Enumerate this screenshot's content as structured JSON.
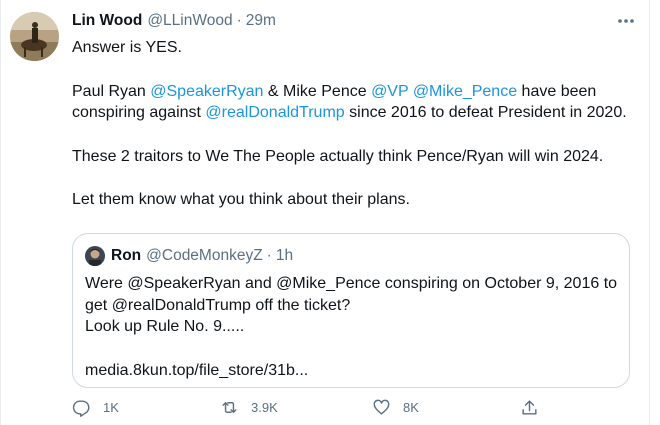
{
  "tweet": {
    "author_name": "Lin Wood",
    "author_handle": "@LLinWood",
    "separator": "·",
    "time": "29m",
    "line1": "Answer is YES.",
    "para2": {
      "t1": "Paul Ryan ",
      "m1": "@SpeakerRyan",
      "t2": " & Mike Pence ",
      "m2": "@VP",
      "t3": " ",
      "m3": "@Mike_Pence",
      "t4": " have been conspiring against ",
      "m4": "@realDonaldTrump",
      "t5": " since 2016 to defeat President in 2020."
    },
    "para3": "These 2 traitors to We The People actually think Pence/Ryan will win 2024.",
    "para4": "Let them know what you think about their plans."
  },
  "quote": {
    "author_name": "Ron",
    "author_handle": "@CodeMonkeyZ",
    "separator": "·",
    "time": "1h",
    "line1": "Were @SpeakerRyan and @Mike_Pence conspiring on October 9, 2016 to get @realDonaldTrump off the ticket?",
    "line2": "Look up Rule No. 9.....",
    "link": "media.8kun.top/file_store/31b..."
  },
  "actions": {
    "reply_count": "1K",
    "retweet_count": "3.9K",
    "like_count": "8K"
  },
  "icons": {
    "more": "more-horizontal-icon",
    "reply": "reply-icon",
    "retweet": "retweet-icon",
    "like": "heart-icon",
    "share": "share-icon"
  },
  "colors": {
    "link": "#1b95e0",
    "secondary_text": "#5b7083",
    "border": "#cfd9de"
  }
}
